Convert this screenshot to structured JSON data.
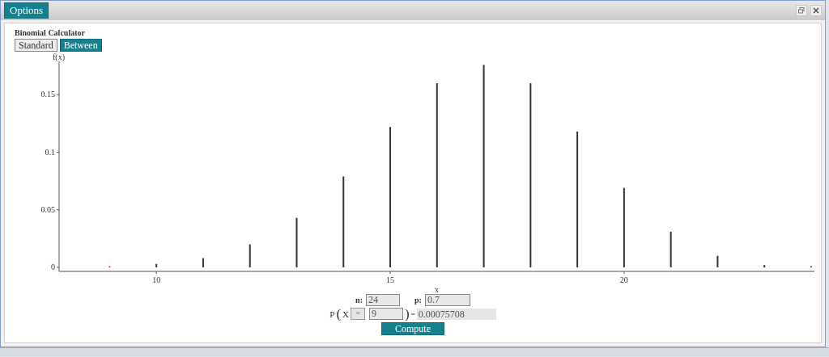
{
  "title_bar": {
    "options_button": "Options"
  },
  "calculator": {
    "title": "Binomial Calculator",
    "modes": [
      {
        "label": "Standard",
        "selected": false
      },
      {
        "label": "Between",
        "selected": true
      }
    ],
    "chart_data": {
      "type": "bar",
      "xlabel": "x",
      "ylabel": "f(x)",
      "x": [
        9,
        10,
        11,
        12,
        13,
        14,
        15,
        16,
        17,
        18,
        19,
        20,
        21,
        22,
        23,
        24
      ],
      "series": [
        {
          "color": "#333333",
          "values": [
            null,
            0.003,
            0.008,
            0.02,
            0.043,
            0.079,
            0.122,
            0.16,
            0.176,
            0.16,
            0.118,
            0.069,
            0.031,
            0.01,
            0.002,
            0.001
          ]
        },
        {
          "color": "#cc2222",
          "values": [
            0.001,
            null,
            null,
            null,
            null,
            null,
            null,
            null,
            null,
            null,
            null,
            null,
            null,
            null,
            null,
            null
          ]
        }
      ],
      "xlim": [
        7.92,
        24.07
      ],
      "ylim": [
        -0.0035,
        0.179
      ],
      "xticks": [
        10,
        15,
        20
      ],
      "yticks": [
        {
          "value": 0,
          "label": "0"
        },
        {
          "value": 0.05,
          "label": "0.05"
        },
        {
          "value": 0.1,
          "label": "0.1"
        },
        {
          "value": 0.15,
          "label": "0.15"
        }
      ]
    },
    "n": {
      "label": "n:",
      "value": "24"
    },
    "p": {
      "label": "p:",
      "value": "0.7"
    },
    "probability": {
      "function": "P",
      "open_paren": "(",
      "variable": "X",
      "operator": "=",
      "value": "9",
      "close_paren": ")",
      "equals": "=",
      "result": "0.00075708"
    },
    "compute_button": "Compute"
  }
}
